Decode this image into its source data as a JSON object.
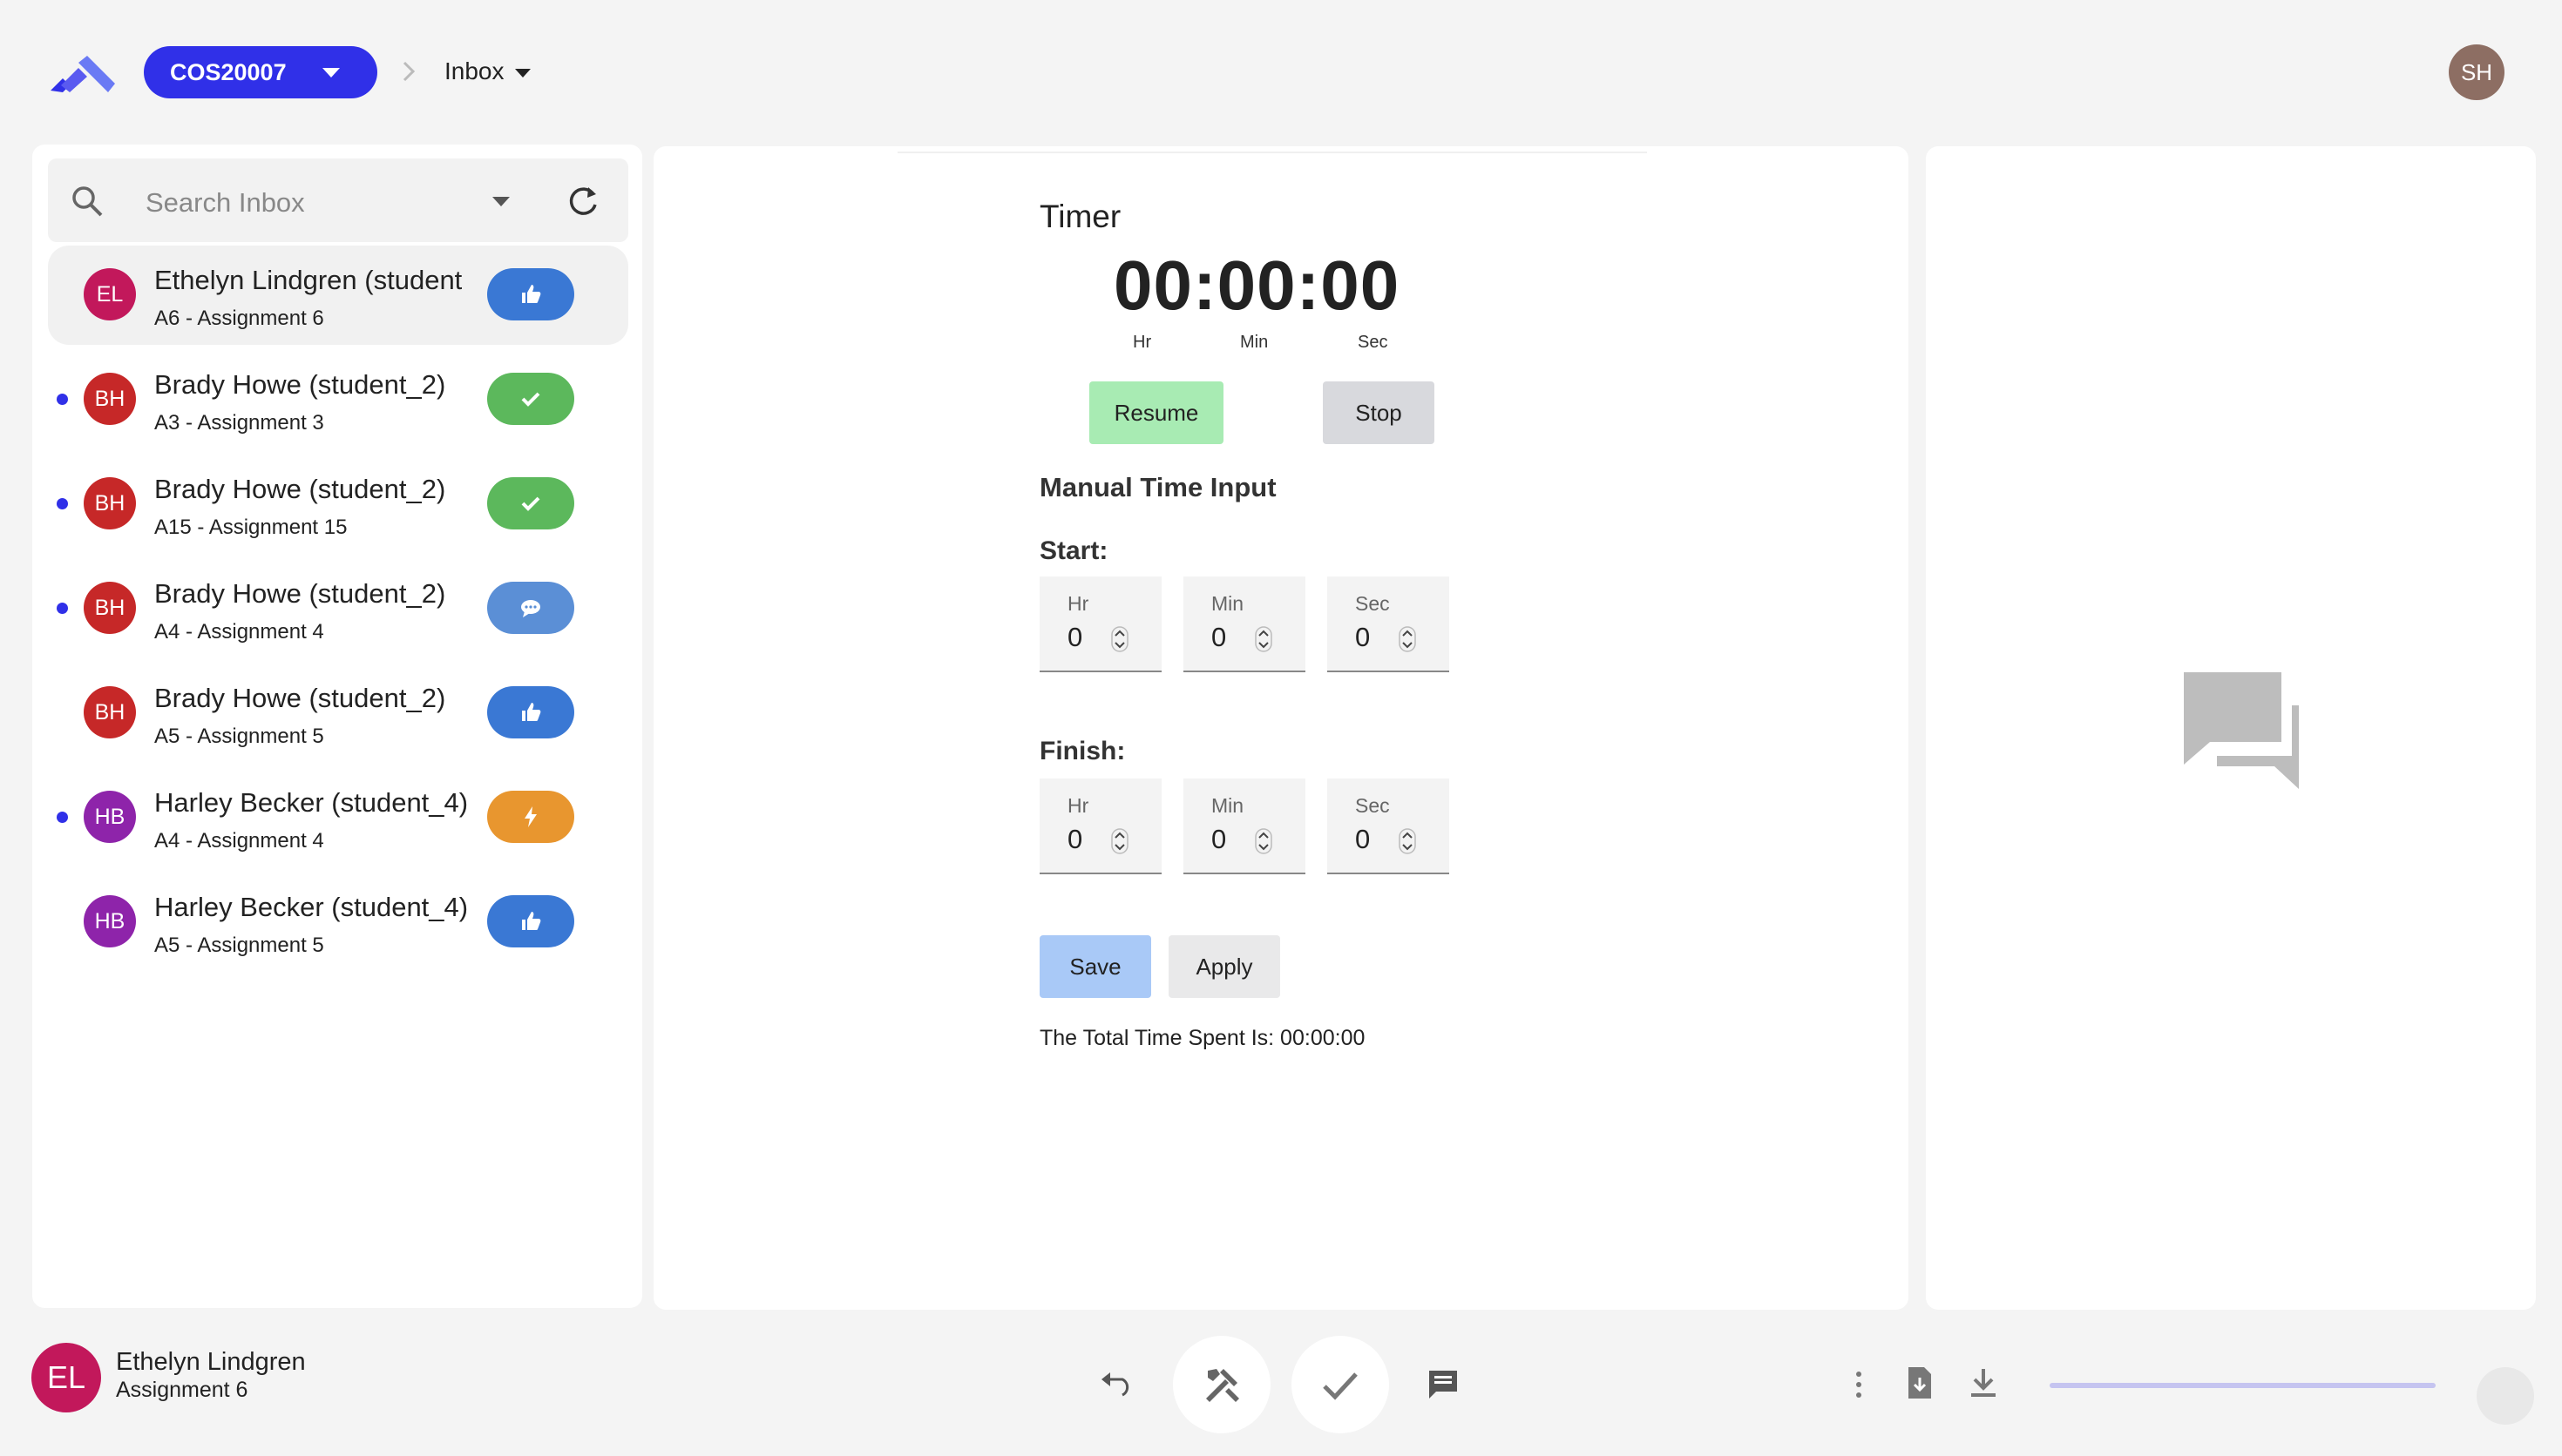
{
  "header": {
    "course_label": "COS20007",
    "breadcrumb_label": "Inbox",
    "user_initials": "SH"
  },
  "inbox": {
    "search_placeholder": "Search Inbox",
    "items": [
      {
        "initials": "EL",
        "name": "Ethelyn Lindgren (student",
        "subtitle": "A6 - Assignment 6",
        "unread": false,
        "selected": true,
        "avatar_color": "#c2185b",
        "status_icon": "thumbs-up-icon",
        "status_color": "#3a78d4"
      },
      {
        "initials": "BH",
        "name": "Brady Howe (student_2)",
        "subtitle": "A3 - Assignment 3",
        "unread": true,
        "selected": false,
        "avatar_color": "#c62828",
        "status_icon": "check-icon",
        "status_color": "#5cb85c"
      },
      {
        "initials": "BH",
        "name": "Brady Howe (student_2)",
        "subtitle": "A15 - Assignment 15",
        "unread": true,
        "selected": false,
        "avatar_color": "#c62828",
        "status_icon": "check-icon",
        "status_color": "#5cb85c"
      },
      {
        "initials": "BH",
        "name": "Brady Howe (student_2)",
        "subtitle": "A4 - Assignment 4",
        "unread": true,
        "selected": false,
        "avatar_color": "#c62828",
        "status_icon": "chat-bubble-icon",
        "status_color": "#5b8fd6"
      },
      {
        "initials": "BH",
        "name": "Brady Howe (student_2)",
        "subtitle": "A5 - Assignment 5",
        "unread": false,
        "selected": false,
        "avatar_color": "#c62828",
        "status_icon": "thumbs-up-icon",
        "status_color": "#3a78d4"
      },
      {
        "initials": "HB",
        "name": "Harley Becker (student_4)",
        "subtitle": "A4 - Assignment 4",
        "unread": true,
        "selected": false,
        "avatar_color": "#8e24aa",
        "status_icon": "lightning-icon",
        "status_color": "#e8962f"
      },
      {
        "initials": "HB",
        "name": "Harley Becker (student_4)",
        "subtitle": "A5 - Assignment 5",
        "unread": false,
        "selected": false,
        "avatar_color": "#8e24aa",
        "status_icon": "thumbs-up-icon",
        "status_color": "#3a78d4"
      }
    ]
  },
  "timer": {
    "title": "Timer",
    "display": "00:00:00",
    "unit_hr": "Hr",
    "unit_min": "Min",
    "unit_sec": "Sec",
    "resume_label": "Resume",
    "stop_label": "Stop",
    "manual_title": "Manual Time Input",
    "start_label": "Start:",
    "finish_label": "Finish:",
    "start": {
      "hr_label": "Hr",
      "hr": "0",
      "min_label": "Min",
      "min": "0",
      "sec_label": "Sec",
      "sec": "0"
    },
    "finish": {
      "hr_label": "Hr",
      "hr": "0",
      "min_label": "Min",
      "min": "0",
      "sec_label": "Sec",
      "sec": "0"
    },
    "save_label": "Save",
    "apply_label": "Apply",
    "total_text": "The Total Time Spent Is: 00:00:00"
  },
  "bottom": {
    "avatar_initials": "EL",
    "student_name": "Ethelyn Lindgren",
    "assignment": "Assignment 6",
    "progress": 1.0
  }
}
